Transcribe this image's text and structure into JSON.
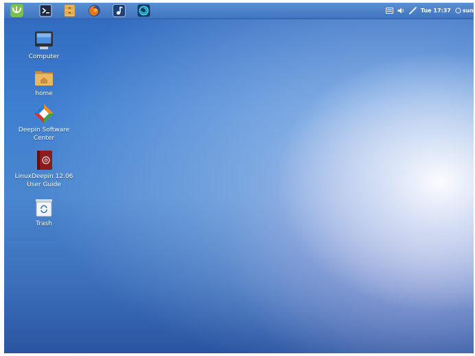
{
  "launchers": [
    {
      "name": "deepin-menu"
    },
    {
      "name": "terminal"
    },
    {
      "name": "file-manager"
    },
    {
      "name": "firefox"
    },
    {
      "name": "music-player"
    },
    {
      "name": "deepin-app"
    }
  ],
  "tray": {
    "clock": "Tue 17:37",
    "user": "sun"
  },
  "desktop_icons": [
    {
      "label": "Computer",
      "icon": "computer-icon"
    },
    {
      "label": "home",
      "icon": "home-folder-icon"
    },
    {
      "label": "Deepin Software Center",
      "icon": "software-center-icon"
    },
    {
      "label": "LinuxDeepin 12.06 User Guide",
      "icon": "user-guide-icon"
    },
    {
      "label": "Trash",
      "icon": "trash-icon"
    }
  ]
}
